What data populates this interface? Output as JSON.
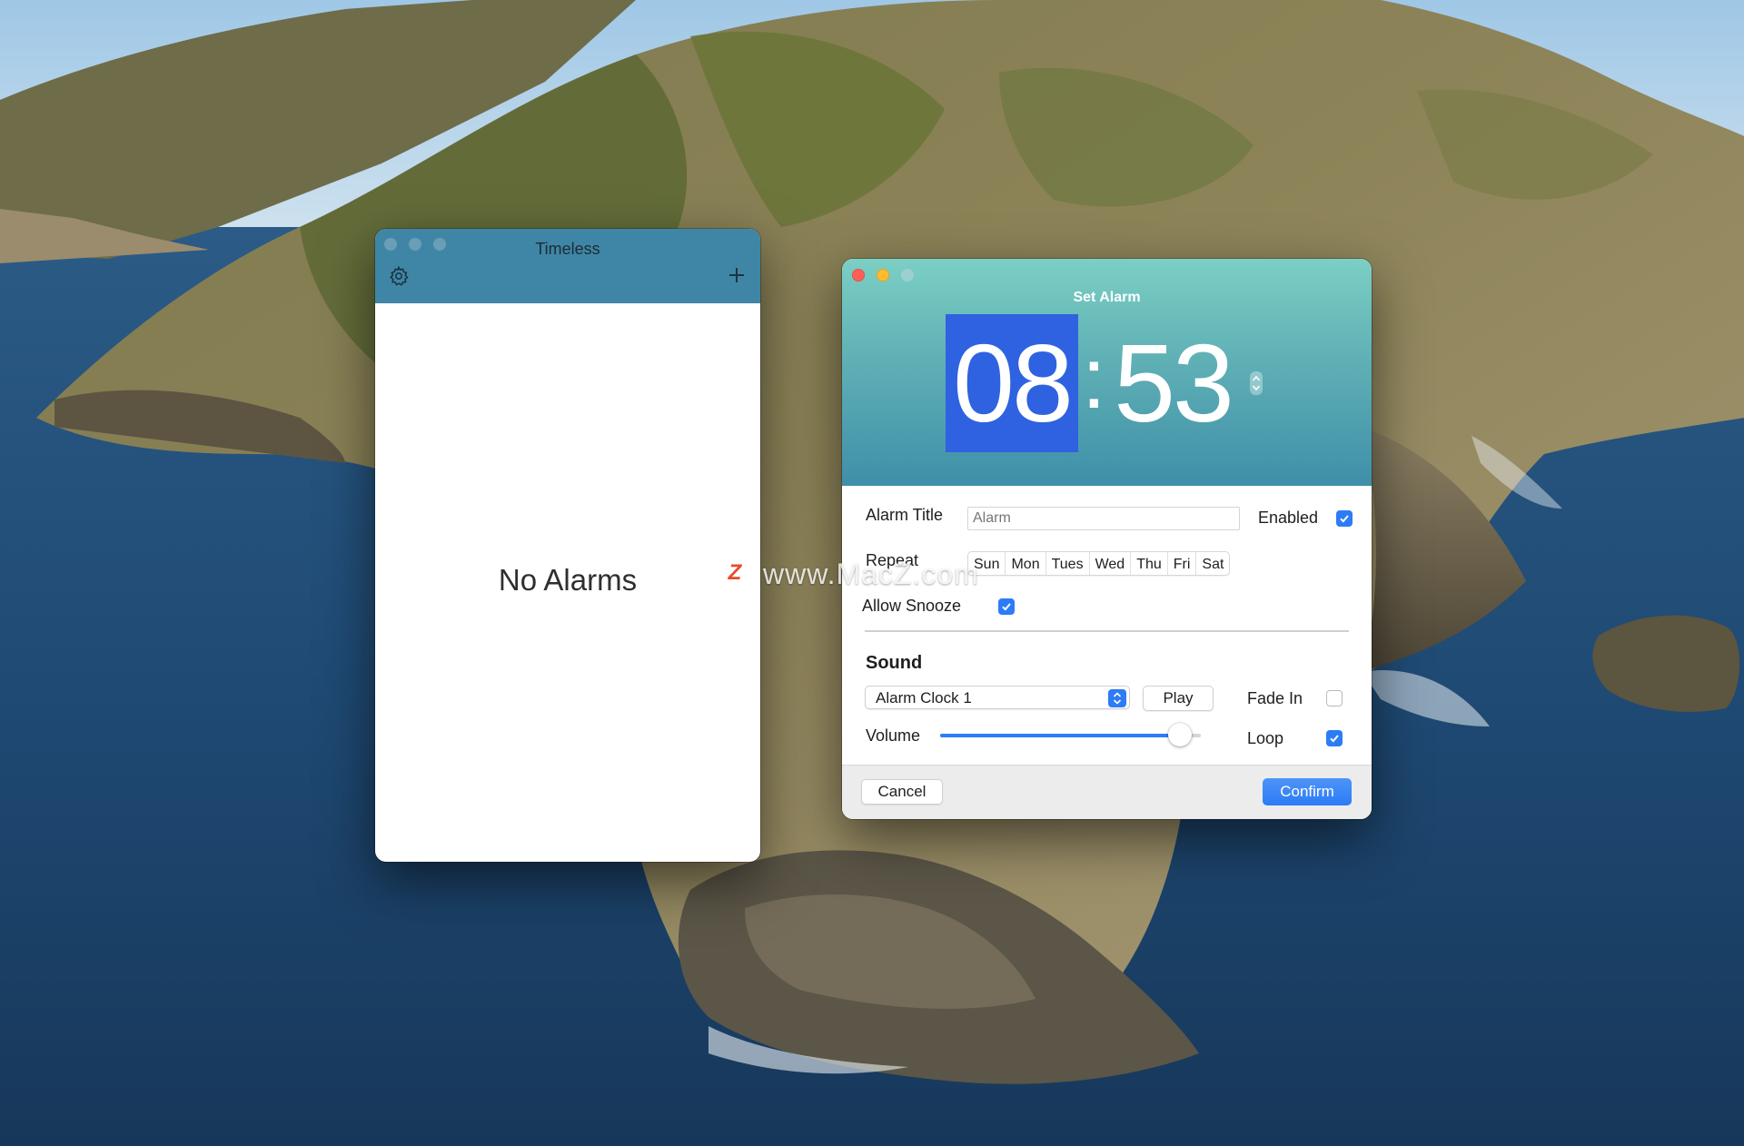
{
  "timeless_window": {
    "title": "Timeless",
    "empty_message": "No Alarms",
    "settings_icon": "gear-icon",
    "add_icon": "plus-icon"
  },
  "set_alarm_window": {
    "title": "Set Alarm",
    "time": {
      "hours": "08",
      "separator": ":",
      "minutes": "53"
    },
    "alarm_title": {
      "label": "Alarm Title",
      "value": "",
      "placeholder": "Alarm"
    },
    "enabled": {
      "label": "Enabled",
      "checked": true
    },
    "repeat": {
      "label": "Repeat",
      "days": [
        "Sun",
        "Mon",
        "Tues",
        "Wed",
        "Thu",
        "Fri",
        "Sat"
      ]
    },
    "allow_snooze": {
      "label": "Allow Snooze",
      "checked": true
    },
    "sound": {
      "heading": "Sound",
      "selected": "Alarm Clock 1",
      "play_label": "Play",
      "fade_in": {
        "label": "Fade In",
        "checked": false
      },
      "volume": {
        "label": "Volume",
        "level": 0.92
      },
      "loop": {
        "label": "Loop",
        "checked": true
      }
    },
    "cancel_label": "Cancel",
    "confirm_label": "Confirm"
  },
  "watermark": {
    "text": "www.MacZ.com",
    "logo": "Z"
  },
  "colors": {
    "accent": "#2d7cf6",
    "timeless_titlebar": "#3f86a6",
    "hours_highlight": "#2f62e0",
    "header_gradient_top": "#7ccfc4",
    "header_gradient_bottom": "#3f8fa9"
  }
}
